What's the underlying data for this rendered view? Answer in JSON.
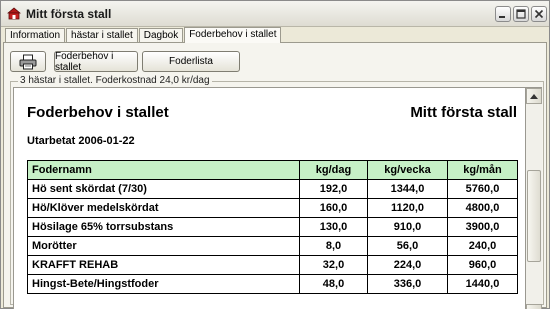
{
  "window": {
    "title": "Mitt första stall",
    "icon": "barn-icon",
    "controls": [
      "minimize-icon",
      "maximize-icon",
      "close-icon"
    ]
  },
  "tabs": [
    {
      "label": "Information"
    },
    {
      "label": "hästar i stallet"
    },
    {
      "label": "Dagbok"
    },
    {
      "label": "Foderbehov i stallet",
      "active": true
    }
  ],
  "toolbar": {
    "print_icon": "printer-icon",
    "foderbehov_label": "Foderbehov i stallet",
    "foderlista_label": "Foderlista"
  },
  "summary": "3 hästar i stallet. Foderkostnad 24,0 kr/dag",
  "report": {
    "title": "Foderbehov i stallet",
    "stall_name": "Mitt första stall",
    "date_line": "Utarbetat 2006-01-22",
    "columns": [
      "Fodernamn",
      "kg/dag",
      "kg/vecka",
      "kg/mån"
    ],
    "rows": [
      [
        "Hö sent skördat (7/30)",
        "192,0",
        "1344,0",
        "5760,0"
      ],
      [
        "Hö/Klöver medelskördat",
        "160,0",
        "1120,0",
        "4800,0"
      ],
      [
        "Hösilage 65% torrsubstans",
        "130,0",
        "910,0",
        "3900,0"
      ],
      [
        "Morötter",
        "8,0",
        "56,0",
        "240,0"
      ],
      [
        "KRAFFT REHAB",
        "32,0",
        "224,0",
        "960,0"
      ],
      [
        "Hingst-Bete/Hingstfoder",
        "48,0",
        "336,0",
        "1440,0"
      ]
    ]
  },
  "colors": {
    "header_bg": "#c6f0c6",
    "window_bg": "#ece9d8"
  }
}
